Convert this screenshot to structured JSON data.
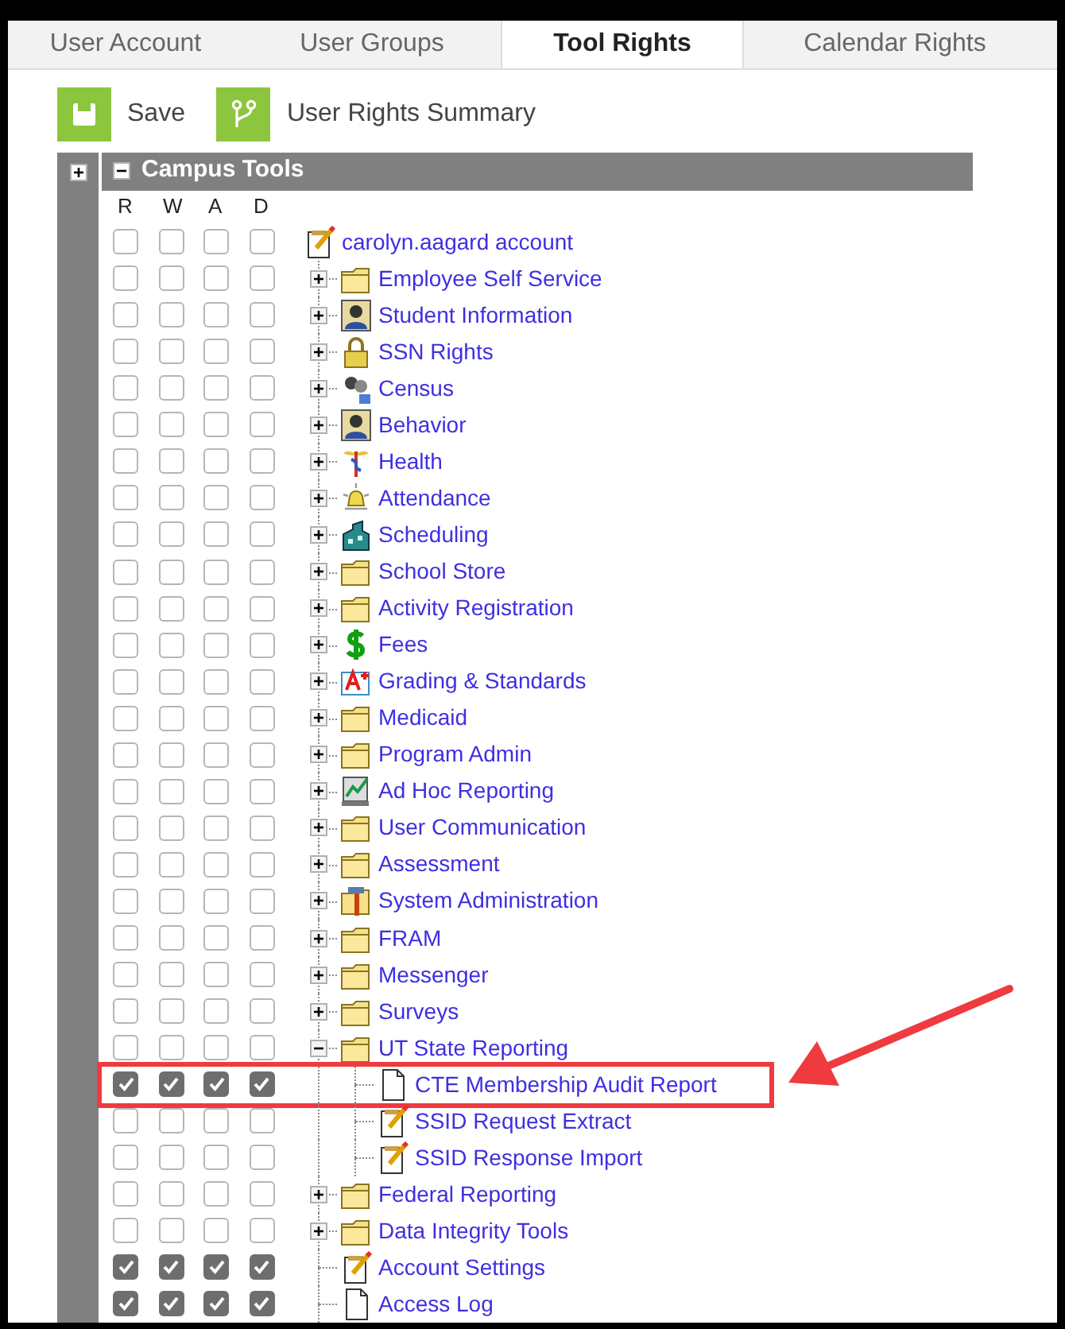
{
  "tabs": [
    {
      "label": "User Account",
      "selected": false
    },
    {
      "label": "User Groups",
      "selected": false
    },
    {
      "label": "Tool Rights",
      "selected": true
    },
    {
      "label": "Calendar Rights",
      "selected": false
    }
  ],
  "toolbar": [
    {
      "label": "Save",
      "kind": "save"
    },
    {
      "label": "User Rights Summary",
      "kind": "summary"
    }
  ],
  "tree": {
    "outer_expanded": false,
    "title": "Campus Tools",
    "expanded": true,
    "column_headers": [
      "R",
      "W",
      "A",
      "D"
    ],
    "root": {
      "label": "carolyn.aagard account",
      "kind": "notepad",
      "checks": [
        false,
        false,
        false,
        false
      ],
      "highlighted": false,
      "children": [
        {
          "label": "Employee Self Service",
          "kind": "folder",
          "expanded": false,
          "checks": [
            false,
            false,
            false,
            false
          ],
          "highlighted": false
        },
        {
          "label": "Student Information",
          "kind": "person",
          "expanded": false,
          "checks": [
            false,
            false,
            false,
            false
          ],
          "highlighted": false
        },
        {
          "label": "SSN Rights",
          "kind": "lock",
          "expanded": false,
          "checks": [
            false,
            false,
            false,
            false
          ],
          "highlighted": false
        },
        {
          "label": "Census",
          "kind": "people",
          "expanded": false,
          "checks": [
            false,
            false,
            false,
            false
          ],
          "highlighted": false
        },
        {
          "label": "Behavior",
          "kind": "person",
          "expanded": false,
          "checks": [
            false,
            false,
            false,
            false
          ],
          "highlighted": false
        },
        {
          "label": "Health",
          "kind": "caduceus",
          "expanded": false,
          "checks": [
            false,
            false,
            false,
            false
          ],
          "highlighted": false
        },
        {
          "label": "Attendance",
          "kind": "bell",
          "expanded": false,
          "checks": [
            false,
            false,
            false,
            false
          ],
          "highlighted": false
        },
        {
          "label": "Scheduling",
          "kind": "building",
          "expanded": false,
          "checks": [
            false,
            false,
            false,
            false
          ],
          "highlighted": false
        },
        {
          "label": "School Store",
          "kind": "folder",
          "expanded": false,
          "checks": [
            false,
            false,
            false,
            false
          ],
          "highlighted": false
        },
        {
          "label": "Activity Registration",
          "kind": "folder",
          "expanded": false,
          "checks": [
            false,
            false,
            false,
            false
          ],
          "highlighted": false
        },
        {
          "label": "Fees",
          "kind": "dollar",
          "expanded": false,
          "checks": [
            false,
            false,
            false,
            false
          ],
          "highlighted": false
        },
        {
          "label": "Grading & Standards",
          "kind": "grade",
          "expanded": false,
          "checks": [
            false,
            false,
            false,
            false
          ],
          "highlighted": false
        },
        {
          "label": "Medicaid",
          "kind": "folder",
          "expanded": false,
          "checks": [
            false,
            false,
            false,
            false
          ],
          "highlighted": false
        },
        {
          "label": "Program Admin",
          "kind": "folder",
          "expanded": false,
          "checks": [
            false,
            false,
            false,
            false
          ],
          "highlighted": false
        },
        {
          "label": "Ad Hoc Reporting",
          "kind": "chart",
          "expanded": false,
          "checks": [
            false,
            false,
            false,
            false
          ],
          "highlighted": false
        },
        {
          "label": "User Communication",
          "kind": "folder",
          "expanded": false,
          "checks": [
            false,
            false,
            false,
            false
          ],
          "highlighted": false
        },
        {
          "label": "Assessment",
          "kind": "folder",
          "expanded": false,
          "checks": [
            false,
            false,
            false,
            false
          ],
          "highlighted": false
        },
        {
          "label": "System Administration",
          "kind": "tools",
          "expanded": false,
          "checks": [
            false,
            false,
            false,
            false
          ],
          "highlighted": false
        },
        {
          "label": "FRAM",
          "kind": "folder",
          "expanded": false,
          "checks": [
            false,
            false,
            false,
            false
          ],
          "highlighted": false
        },
        {
          "label": "Messenger",
          "kind": "folder",
          "expanded": false,
          "checks": [
            false,
            false,
            false,
            false
          ],
          "highlighted": false
        },
        {
          "label": "Surveys",
          "kind": "folder",
          "expanded": false,
          "checks": [
            false,
            false,
            false,
            false
          ],
          "highlighted": false
        },
        {
          "label": "UT State Reporting",
          "kind": "folder",
          "expanded": true,
          "checks": [
            false,
            false,
            false,
            false
          ],
          "highlighted": false,
          "children": [
            {
              "label": "CTE Membership Audit Report",
              "kind": "document",
              "checks": [
                true,
                true,
                true,
                true
              ],
              "highlighted": true
            },
            {
              "label": "SSID Request Extract",
              "kind": "notepad",
              "checks": [
                false,
                false,
                false,
                false
              ],
              "highlighted": false
            },
            {
              "label": "SSID Response Import",
              "kind": "notepad",
              "checks": [
                false,
                false,
                false,
                false
              ],
              "highlighted": false
            }
          ]
        },
        {
          "label": "Federal Reporting",
          "kind": "folder",
          "expanded": false,
          "checks": [
            false,
            false,
            false,
            false
          ],
          "highlighted": false
        },
        {
          "label": "Data Integrity Tools",
          "kind": "folder",
          "expanded": false,
          "checks": [
            false,
            false,
            false,
            false
          ],
          "highlighted": false
        },
        {
          "label": "Account Settings",
          "kind": "notepad",
          "checks": [
            true,
            true,
            true,
            true
          ],
          "highlighted": false
        },
        {
          "label": "Access Log",
          "kind": "document",
          "checks": [
            true,
            true,
            true,
            true
          ],
          "highlighted": false
        }
      ]
    }
  }
}
